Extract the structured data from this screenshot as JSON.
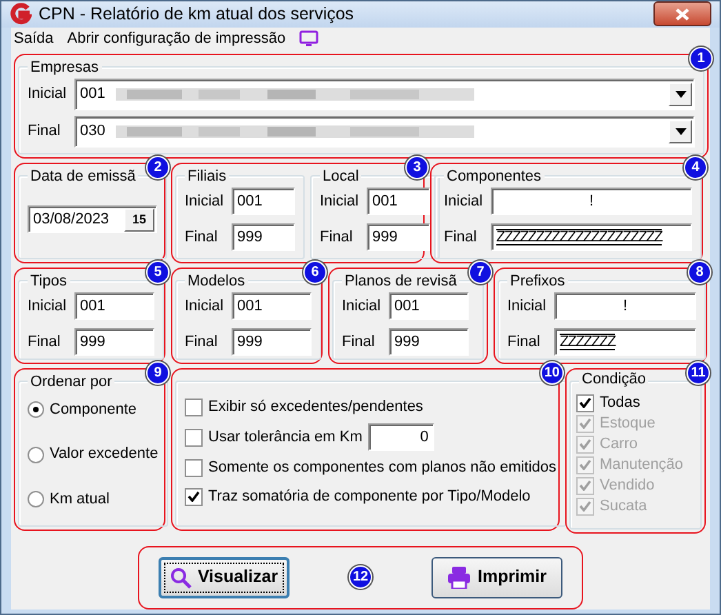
{
  "window": {
    "title": "CPN - Relatório de km atual dos serviços"
  },
  "menu": [
    {
      "label": "Saída",
      "kind": "text"
    },
    {
      "label": "Abrir configuração de impressão",
      "kind": "text"
    },
    {
      "kind": "monitor"
    }
  ],
  "empresas": {
    "badge": "1",
    "title": "Empresas",
    "rows": [
      {
        "label": "Inicial",
        "value": "001"
      },
      {
        "label": "Final",
        "value": "030"
      }
    ]
  },
  "data_emissao": {
    "badge": "2",
    "title": "Data de emissã",
    "value": "03/08/2023",
    "calendar_button": "15"
  },
  "filiais_local": {
    "badge": "3",
    "groups": [
      {
        "title": "Filiais",
        "rows": [
          {
            "label": "Inicial",
            "value": "001"
          },
          {
            "label": "Final",
            "value": "999"
          }
        ]
      },
      {
        "title": "Local",
        "rows": [
          {
            "label": "Inicial",
            "value": "001"
          },
          {
            "label": "Final",
            "value": "999"
          }
        ]
      }
    ]
  },
  "componentes": {
    "badge": "4",
    "title": "Componentes",
    "rows": [
      {
        "label": "Inicial",
        "value": "!"
      },
      {
        "label": "Final",
        "value": "ZZZZZZZZZZZZZZZZZZZZZ"
      }
    ]
  },
  "tipos": {
    "badge": "5",
    "title": "Tipos",
    "rows": [
      {
        "label": "Inicial",
        "value": "001"
      },
      {
        "label": "Final",
        "value": "999"
      }
    ]
  },
  "modelos": {
    "badge": "6",
    "title": "Modelos",
    "rows": [
      {
        "label": "Inicial",
        "value": "001"
      },
      {
        "label": "Final",
        "value": "999"
      }
    ]
  },
  "planos": {
    "badge": "7",
    "title": "Planos de revisã",
    "rows": [
      {
        "label": "Inicial",
        "value": "001"
      },
      {
        "label": "Final",
        "value": "999"
      }
    ]
  },
  "prefixos": {
    "badge": "8",
    "title": "Prefixos",
    "rows": [
      {
        "label": "Inicial",
        "value": "!"
      },
      {
        "label": "Final",
        "value": "ZZZZZZZ"
      }
    ]
  },
  "ordenar": {
    "badge": "9",
    "title": "Ordenar por",
    "options": [
      {
        "label": "Componente",
        "selected": true
      },
      {
        "label": "Valor excedente",
        "selected": false
      },
      {
        "label": "Km atual",
        "selected": false
      }
    ]
  },
  "opcoes": {
    "badge": "10",
    "items": [
      {
        "kind": "check",
        "label": "Exibir só excedentes/pendentes",
        "checked": false
      },
      {
        "kind": "check_number",
        "label": "Usar tolerância em Km",
        "checked": false,
        "value": "0"
      },
      {
        "kind": "check",
        "label": "Somente os componentes com planos não emitidos",
        "checked": false
      },
      {
        "kind": "check",
        "label": "Traz somatória de componente por Tipo/Modelo",
        "checked": true
      }
    ]
  },
  "condicao": {
    "badge": "11",
    "title": "Condição",
    "items": [
      {
        "label": "Todas",
        "checked": true,
        "disabled": false
      },
      {
        "label": "Estoque",
        "checked": true,
        "disabled": true
      },
      {
        "label": "Carro",
        "checked": true,
        "disabled": true
      },
      {
        "label": "Manutenção",
        "checked": true,
        "disabled": true
      },
      {
        "label": "Vendido",
        "checked": true,
        "disabled": true
      },
      {
        "label": "Sucata",
        "checked": true,
        "disabled": true
      }
    ]
  },
  "actions": {
    "badge": "12",
    "buttons": [
      {
        "kind": "search",
        "label": "Visualizar",
        "focused": true
      },
      {
        "kind": "print",
        "label": "Imprimir",
        "focused": false
      }
    ]
  }
}
